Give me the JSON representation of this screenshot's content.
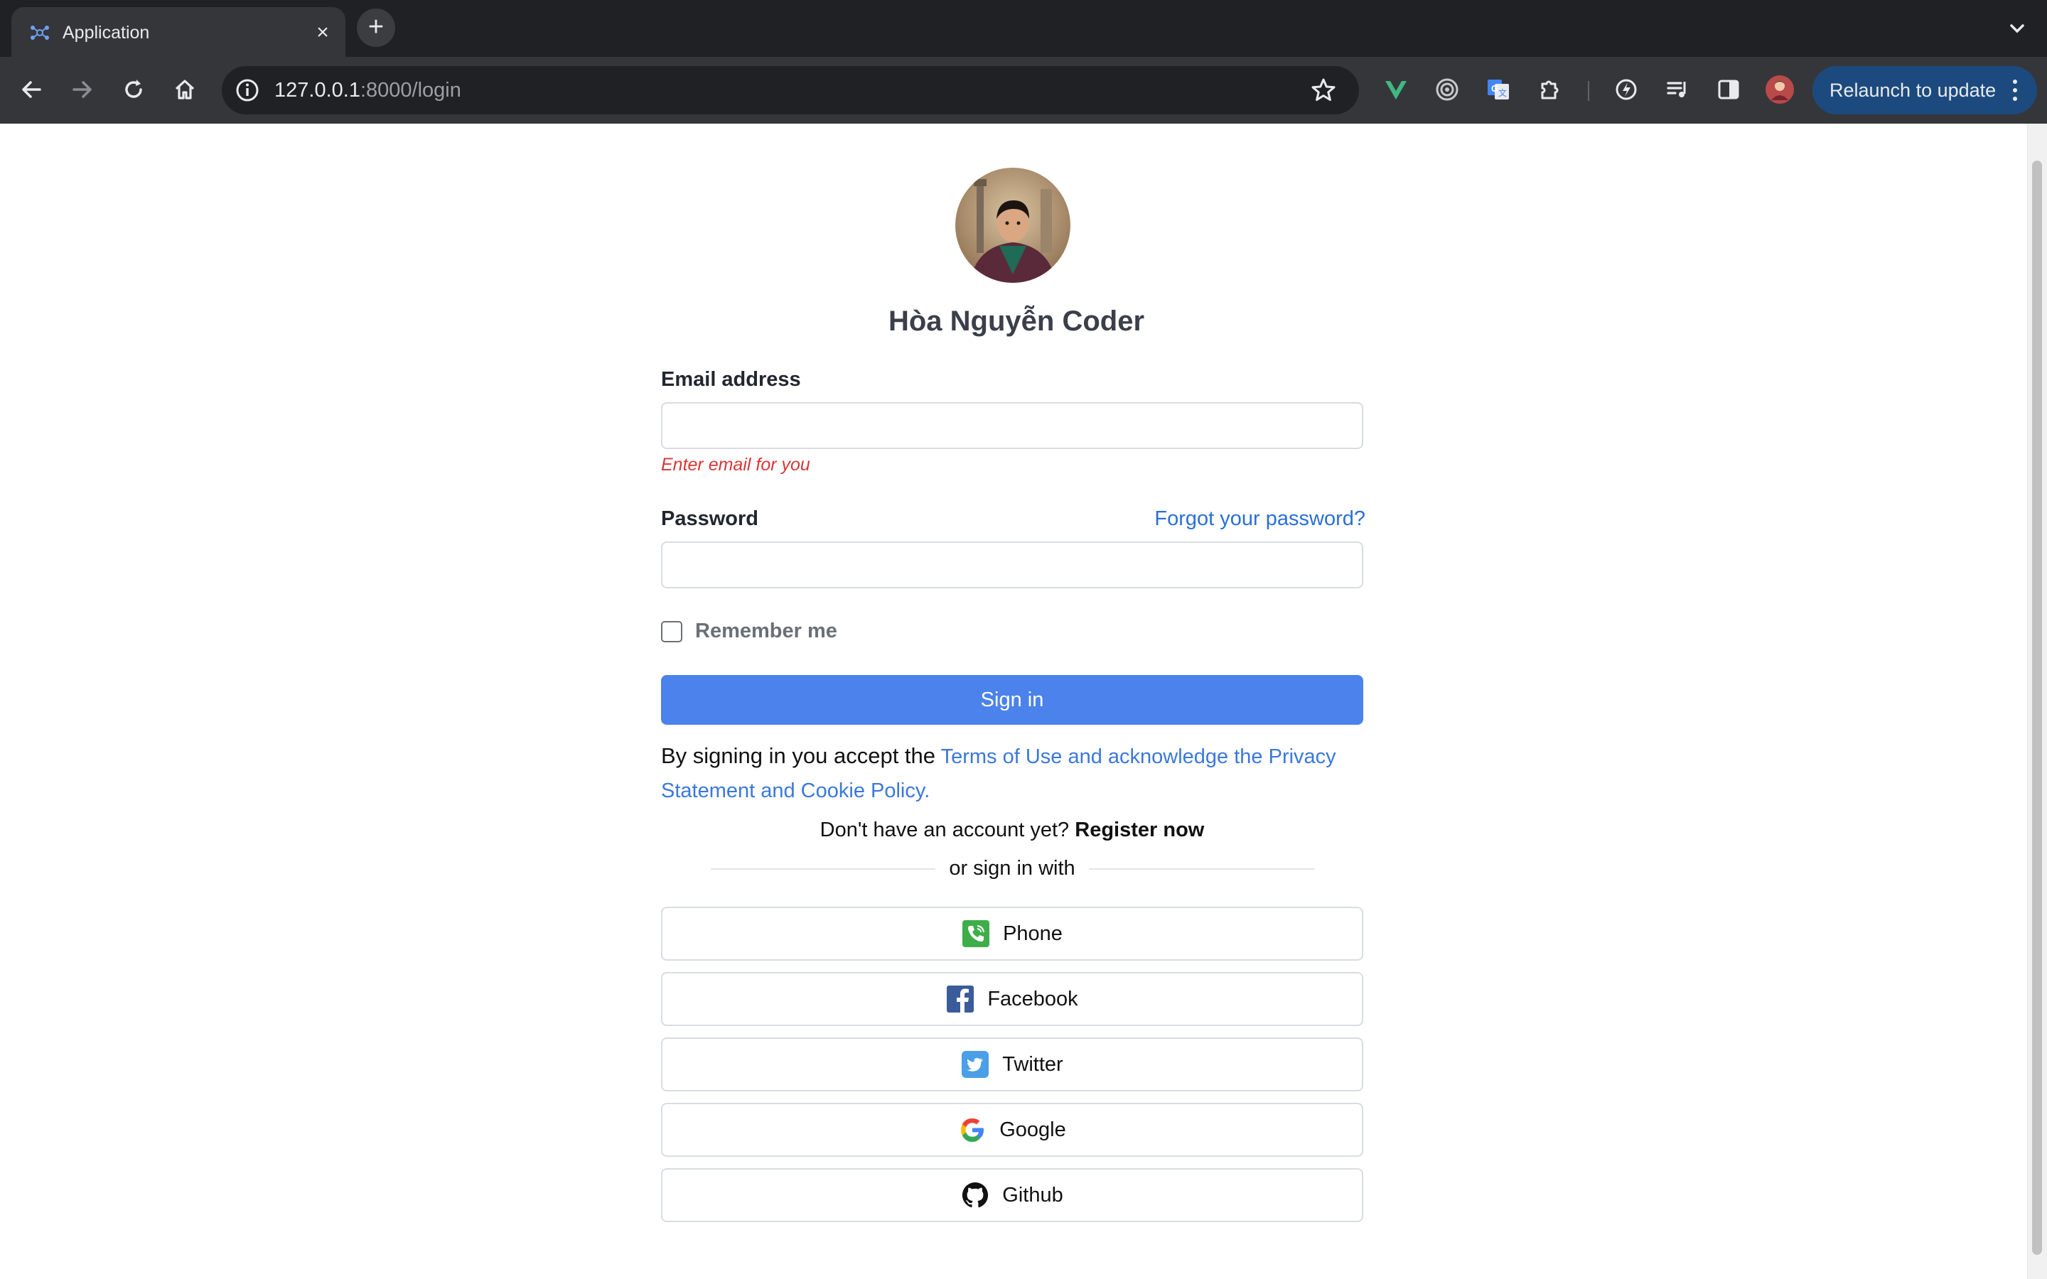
{
  "browser": {
    "tab_title": "Application",
    "url_host": "127.0.0.1",
    "url_path": ":8000/login",
    "relaunch_label": "Relaunch to update"
  },
  "login": {
    "site_title": "Hòa Nguyễn Coder",
    "email_label": "Email address",
    "email_value": "",
    "email_error": "Enter email for you",
    "password_label": "Password",
    "password_value": "",
    "forgot_label": "Forgot your password?",
    "remember_label": "Remember me",
    "remember_checked": false,
    "signin_label": "Sign in",
    "terms_intro": "By signing in you accept the",
    "terms_link": "Terms of Use and acknowledge the Privacy Statement and Cookie Policy.",
    "register_prompt": "Don't have an account yet?",
    "register_link": "Register now",
    "divider_label": "or sign in with",
    "social": [
      {
        "label": "Phone",
        "icon": "phone-icon"
      },
      {
        "label": "Facebook",
        "icon": "facebook-icon"
      },
      {
        "label": "Twitter",
        "icon": "twitter-icon"
      },
      {
        "label": "Google",
        "icon": "google-icon"
      },
      {
        "label": "Github",
        "icon": "github-icon"
      }
    ]
  },
  "colors": {
    "primary": "#4b82ec",
    "link": "#3a78dc",
    "error": "#d93636",
    "chrome_dark": "#202124"
  }
}
